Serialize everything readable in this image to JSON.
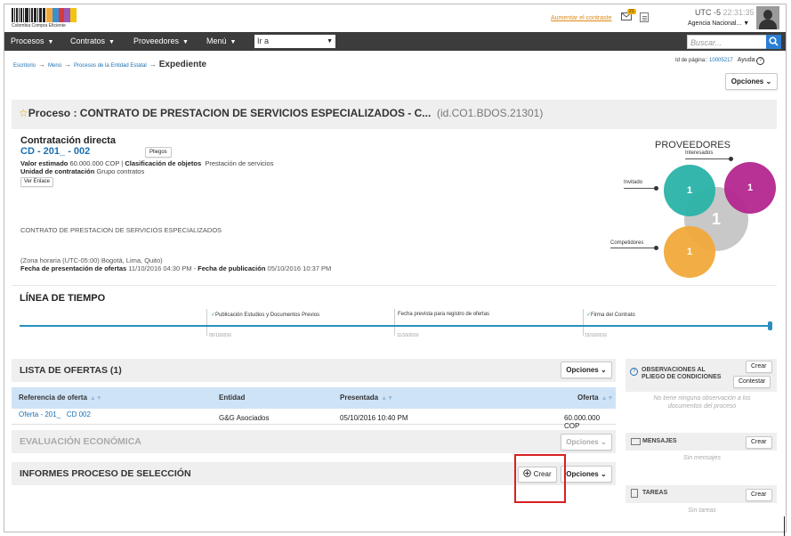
{
  "header": {
    "logo_text": "Colombia Compra Eficiente",
    "contrast_link": "Aumentar el contraste",
    "mail_badge": "21",
    "utc_label": "UTC -5",
    "utc_time": "22:31:35",
    "agency": "Agencia Nacional..."
  },
  "nav": {
    "items": [
      "Procesos",
      "Contratos",
      "Proveedores",
      "Menú"
    ],
    "goto_value": "Ir a",
    "search_placeholder": "Buscar..."
  },
  "breadcrumb": {
    "items": [
      "Escritorio",
      "Menú",
      "Procesos de la Entidad Estatal"
    ],
    "current": "Expediente",
    "page_id_label": "Id de página::",
    "page_id": "10005217",
    "help": "Ayuda",
    "help_icon": "?"
  },
  "options_label": "Opciones",
  "process": {
    "title": "Proceso : CONTRATO DE PRESTACION DE SERVICIOS ESPECIALIZADOS - C...",
    "id": "(id.CO1.BDOS.21301)",
    "modality": "Contratación directa",
    "number": "CD - 201_ - 002",
    "pliegos_button": "Pliegos",
    "valor_label": "Valor estimado",
    "valor": "60.000.000 COP",
    "clasif_label": "Clasificación de objetos",
    "clasif_value": "Prestación de servicios",
    "unidad_label": "Unidad de contratación",
    "unidad_value": "Grupo contratos",
    "ver_enlace": "Ver Enlace",
    "description": "CONTRATO DE PRESTACION DE SERVICIOS ESPECIALIZADOS",
    "timezone": "(Zona horaria (UTC-05:00) Bogotá, Lima, Quito)",
    "pres_label": "Fecha de presentación de ofertas",
    "pres_value": "11/10/2016 04:30 PM",
    "pub_label": "Fecha de publicación",
    "pub_value": "05/10/2016 10:37 PM"
  },
  "proveedores": {
    "title": "PROVEEDORES",
    "interesados_label": "Interesados",
    "invitado_label": "Invitado",
    "competidores_label": "Competidores",
    "invitado_count": "1",
    "interesados_count": "1",
    "total_count": "1",
    "competidores_count": "1",
    "colors": {
      "invitado": "#2bb3a8",
      "interesados": "#b5268f",
      "total": "#c8c8c8",
      "competidores": "#f2a93b"
    }
  },
  "timeline": {
    "title": "LÍNEA DE TIEMPO",
    "steps": [
      {
        "label": "Publicación Estudios y Documentos Previos",
        "date": "05/10/2016",
        "checked": true
      },
      {
        "label": "Fecha prevista para registro de ofertas",
        "date": "11/10/2016",
        "checked": false
      },
      {
        "label": "Firma del Contrato",
        "date": "15/10/2016",
        "checked": true
      }
    ]
  },
  "ofertas": {
    "title": "LISTA DE OFERTAS (1)",
    "columns": [
      "Referencia de oferta",
      "Entidad",
      "Presentada",
      "Oferta"
    ],
    "rows": [
      {
        "ref": "Oferta - 201_",
        "ref2": "CD 002",
        "entidad": "G&G Asociados",
        "presentada": "05/10/2016 10:40 PM",
        "oferta": "60.000.000 COP"
      }
    ]
  },
  "evaluacion": {
    "title": "EVALUACIÓN ECONÓMICA"
  },
  "informes": {
    "title": "INFORMES PROCESO DE SELECCIÓN",
    "crear": "Crear"
  },
  "right_panel": {
    "observaciones_title": "OBSERVACIONES AL PLIEGO DE CONDICIONES",
    "crear": "Crear",
    "contestar": "Contestar",
    "observaciones_empty": "No tiene ninguna observación a los documentos del proceso",
    "mensajes_title": "MENSAJES",
    "mensajes_empty": "Sin mensajes",
    "tareas_title": "TAREAS",
    "tareas_empty": "Sin tareas"
  }
}
